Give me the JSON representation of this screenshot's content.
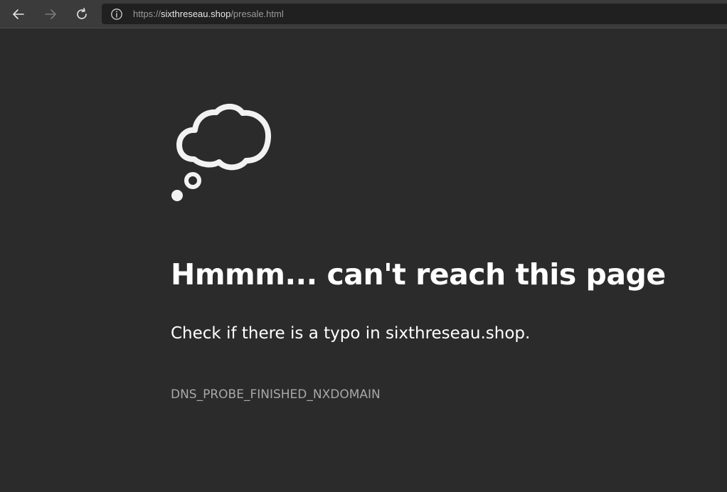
{
  "toolbar": {
    "back_icon": "arrow-left-icon",
    "forward_icon": "arrow-right-icon",
    "refresh_icon": "refresh-icon"
  },
  "address_bar": {
    "info_icon": "info-icon",
    "url_prefix": "https://",
    "url_host": "sixthreseau.shop",
    "url_path": "/presale.html"
  },
  "error_page": {
    "icon": "thought-cloud-icon",
    "title": "Hmmm... can't reach this page",
    "message": "Check if there is a typo in sixthreseau.shop.",
    "error_code": "DNS_PROBE_FINISHED_NXDOMAIN"
  },
  "colors": {
    "page_background": "#2b2b2b",
    "toolbar_background": "#3b3b3b",
    "address_background": "#202020",
    "text_primary": "#ffffff",
    "text_secondary": "#a8a8a8"
  }
}
